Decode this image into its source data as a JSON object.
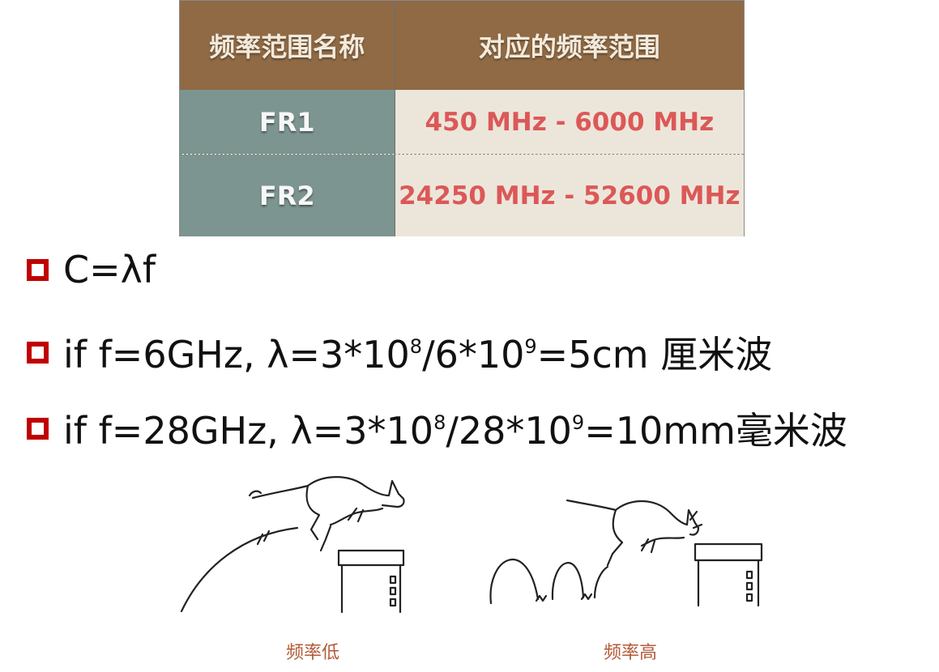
{
  "table": {
    "headers": [
      "频率范围名称",
      "对应的频率范围"
    ],
    "rows": [
      {
        "name": "FR1",
        "range": "450 MHz - 6000 MHz"
      },
      {
        "name": "FR2",
        "range": "24250 MHz - 52600 MHz"
      }
    ]
  },
  "bullets": {
    "b1": {
      "text": "C=λf"
    },
    "b2": {
      "pre": "if f=6GHz, λ=3*10",
      "exp1": "8",
      "mid": "/6*10",
      "exp2": "9",
      "post": "=5cm 厘米波"
    },
    "b3": {
      "pre": "if f=28GHz, λ=3*10",
      "exp1": "8",
      "mid": "/28*10",
      "exp2": "9",
      "post": "=10mm毫米波"
    }
  },
  "captions": {
    "low": "频率低",
    "high": "频率高"
  },
  "colors": {
    "header_bg": "#8f6a45",
    "name_bg": "#7c9590",
    "range_bg": "#ece6da",
    "range_text": "#dc5858",
    "bullet_box": "#c00000",
    "caption_text": "#b25a38"
  }
}
